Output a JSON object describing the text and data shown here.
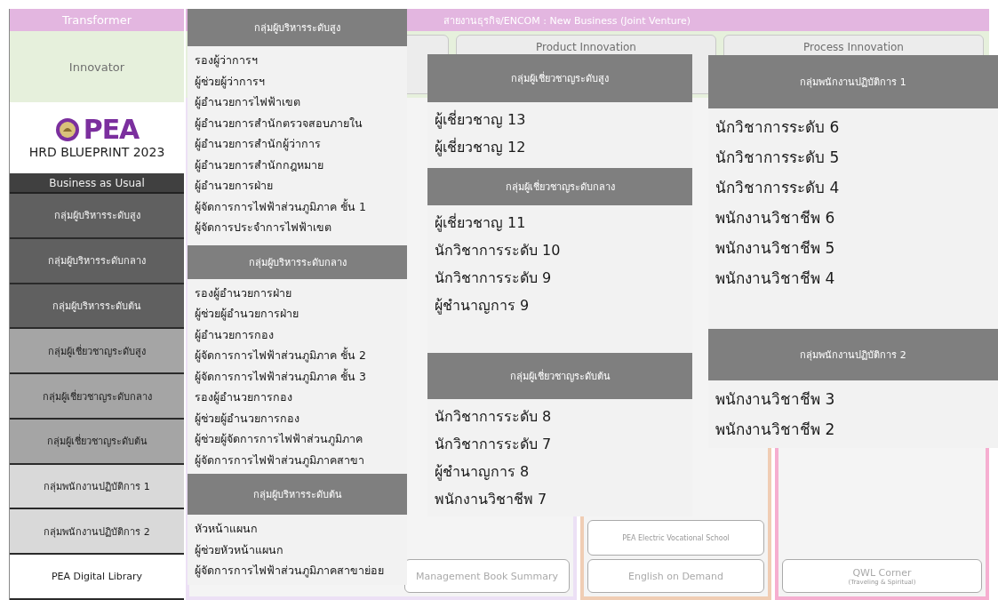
{
  "sidebar": {
    "transformer": "Transformer",
    "innovator": "Innovator",
    "logo": {
      "mark": "PEA",
      "title": "HRD BLUEPRINT 2023"
    },
    "section": "Business as Usual",
    "items": [
      {
        "label": "กลุ่มผู้บริหารระดับสูง",
        "kind": "exec"
      },
      {
        "label": "กลุ่มผู้บริหารระดับกลาง",
        "kind": "exec"
      },
      {
        "label": "กลุ่มผู้บริหารระดับต้น",
        "kind": "exec"
      },
      {
        "label": "กลุ่มผู้เชี่ยวชาญระดับสูง",
        "kind": "expert"
      },
      {
        "label": "กลุ่มผู้เชี่ยวชาญระดับกลาง",
        "kind": "expert"
      },
      {
        "label": "กลุ่มผู้เชี่ยวชาญระดับต้น",
        "kind": "expert"
      },
      {
        "label": "กลุ่มพนักงานปฏิบัติการ 1",
        "kind": "staff"
      },
      {
        "label": "กลุ่มพนักงานปฏิบัติการ 2",
        "kind": "staff"
      },
      {
        "label": "PEA Digital Library",
        "kind": "link"
      }
    ]
  },
  "background": {
    "header": "สายงานธุรกิจ/ENCOM : New Business (Joint Venture)",
    "innovation": [
      "Product Innovation",
      "Process Innovation"
    ],
    "school": "PEA Electric Vocational School",
    "bottom": [
      {
        "label": "Management Book Summary"
      },
      {
        "label": "English on Demand"
      },
      {
        "label": "QWL Corner",
        "note": "(Traveling & Spiritual)"
      }
    ]
  },
  "popups": [
    [
      {
        "title": "กลุ่มผู้บริหารระดับสูง",
        "items": [
          "รองผู้ว่าการฯ",
          "ผู้ช่วยผู้ว่าการฯ",
          "ผู้อำนวยการไฟฟ้าเขต",
          "ผู้อำนวยการสำนักตรวจสอบภายใน",
          "ผู้อำนวยการสำนักผู้ว่าการ",
          "ผู้อำนวยการสำนักกฎหมาย",
          "ผู้อำนวยการฝ่าย",
          "ผู้จัดการการไฟฟ้าส่วนภูมิภาค ชั้น 1",
          "ผู้จัดการประจำการไฟฟ้าเขต"
        ]
      },
      {
        "title": "กลุ่มผู้บริหารระดับกลาง",
        "items": [
          "รองผู้อำนวยการฝ่าย",
          "ผู้ช่วยผู้อำนวยการฝ่าย",
          "ผู้อำนวยการกอง",
          "ผู้จัดการการไฟฟ้าส่วนภูมิภาค ชั้น 2",
          "ผู้จัดการการไฟฟ้าส่วนภูมิภาค ชั้น 3",
          "รองผู้อำนวยการกอง",
          "ผู้ช่วยผู้อำนวยการกอง",
          "ผู้ช่วยผู้จัดการการไฟฟ้าส่วนภูมิภาค",
          "ผู้จัดการการไฟฟ้าส่วนภูมิภาคสาขา"
        ]
      },
      {
        "title": "กลุ่มผู้บริหารระดับต้น",
        "items": [
          "หัวหน้าแผนก",
          "ผู้ช่วยหัวหน้าแผนก",
          "ผู้จัดการการไฟฟ้าส่วนภูมิภาคสาขาย่อย"
        ]
      }
    ],
    [
      {
        "title": "กลุ่มผู้เชี่ยวชาญระดับสูง",
        "items": [
          "ผู้เชี่ยวชาญ 13",
          "ผู้เชี่ยวชาญ 12"
        ]
      },
      {
        "title": "กลุ่มผู้เชี่ยวชาญระดับกลาง",
        "items": [
          "ผู้เชี่ยวชาญ 11",
          "นักวิชาการระดับ 10",
          "นักวิชาการระดับ 9",
          "ผู้ชำนาญการ 9"
        ]
      },
      {
        "title": "กลุ่มผู้เชี่ยวชาญระดับต้น",
        "items": [
          "นักวิชาการระดับ 8",
          "นักวิชาการระดับ 7",
          "ผู้ชำนาญการ 8",
          "พนักงานวิชาชีพ 7"
        ]
      }
    ],
    [
      {
        "title": "กลุ่มพนักงานปฏิบัติการ 1",
        "items": [
          "นักวิชาการระดับ 6",
          "นักวิชาการระดับ 5",
          "นักวิชาการระดับ 4",
          "พนักงานวิชาชีพ 6",
          "พนักงานวิชาชีพ 5",
          "พนักงานวิชาชีพ 4"
        ]
      },
      {
        "title": "กลุ่มพนักงานปฏิบัติการ 2",
        "items": [
          "พนักงานวิชาชีพ 3",
          "พนักงานวิชาชีพ 2"
        ]
      }
    ]
  ]
}
